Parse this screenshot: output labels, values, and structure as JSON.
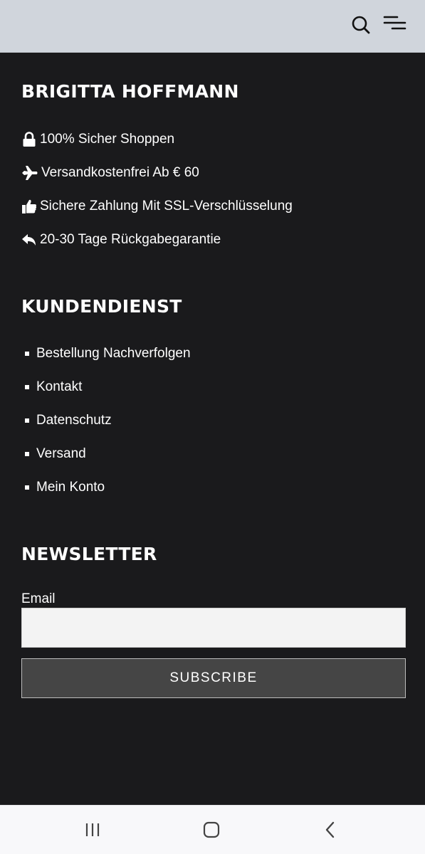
{
  "header": {
    "icons": [
      "search-icon",
      "menu-icon"
    ]
  },
  "brand_section": {
    "title": "BRIGITTA HOFFMANN",
    "features": [
      {
        "icon": "lock-icon",
        "label": "100% Sicher Shoppen"
      },
      {
        "icon": "airplane-icon",
        "label": "Versandkostenfrei Ab € 60"
      },
      {
        "icon": "thumbs-up-icon",
        "label": "Sichere Zahlung Mit SSL-Verschlüsselung"
      },
      {
        "icon": "reply-arrow-icon",
        "label": "20-30 Tage Rückgabegarantie"
      }
    ]
  },
  "service_section": {
    "title": "KUNDENDIENST",
    "links": [
      "Bestellung Nachverfolgen",
      "Kontakt",
      "Datenschutz",
      "Versand",
      "Mein Konto"
    ]
  },
  "newsletter": {
    "title": "NEWSLETTER",
    "email_label": "Email",
    "email_value": "",
    "button_label": "SUBSCRIBE"
  },
  "android_nav": {
    "icons": [
      "recent-apps-icon",
      "home-icon",
      "back-icon"
    ]
  },
  "colors": {
    "header_bg": "#d0d5dc",
    "page_bg": "#1a1a1c",
    "button_bg": "#454545",
    "input_bg": "#f3f3f3"
  }
}
